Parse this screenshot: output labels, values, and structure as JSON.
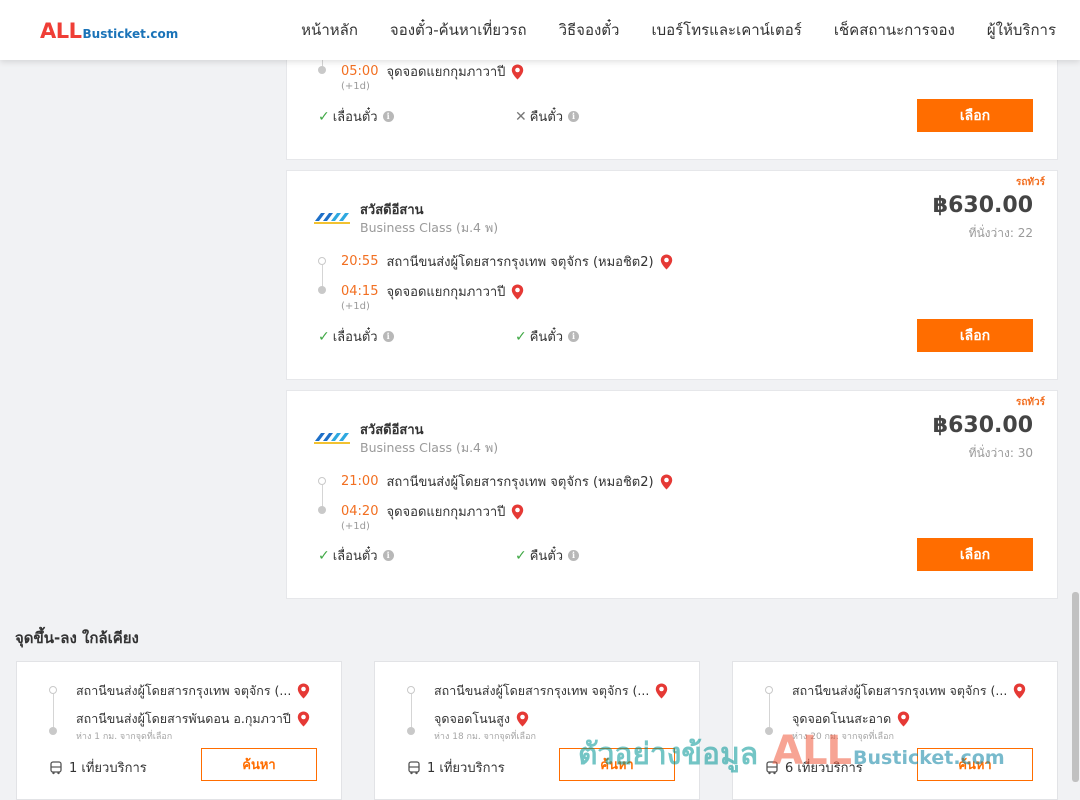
{
  "brand": {
    "logo_all": "ALL",
    "logo_rest": "Busticket.com"
  },
  "nav": [
    "หน้าหลัก",
    "จองตั๋ว-ค้นหาเที่ยวรถ",
    "วิธีจองตั๋ว",
    "เบอร์โทรและเคาน์เตอร์",
    "เช็คสถานะการจอง",
    "ผู้ให้บริการ"
  ],
  "trips": [
    {
      "arrival_time": "05:00",
      "arrival_place": "จุดจอดแยกกุมภาวาปี",
      "arrival_day_offset": "(+1d)",
      "change_label": "เลื่อนตั๋ว",
      "change_allowed": true,
      "refund_label": "คืนตั๋ว",
      "refund_allowed": false,
      "select_label": "เลือก"
    },
    {
      "tag": "รถทัวร์",
      "operator": "สวัสดีอีสาน",
      "class": "Business Class (ม.4 พ)",
      "price": "฿630.00",
      "seats": "ที่นั่งว่าง: 22",
      "departure_time": "20:55",
      "departure_place": "สถานีขนส่งผู้โดยสารกรุงเทพ จตุจักร (หมอชิต2)",
      "arrival_time": "04:15",
      "arrival_place": "จุดจอดแยกกุมภาวาปี",
      "arrival_day_offset": "(+1d)",
      "change_label": "เลื่อนตั๋ว",
      "change_allowed": true,
      "refund_label": "คืนตั๋ว",
      "refund_allowed": true,
      "select_label": "เลือก"
    },
    {
      "tag": "รถทัวร์",
      "operator": "สวัสดีอีสาน",
      "class": "Business Class (ม.4 พ)",
      "price": "฿630.00",
      "seats": "ที่นั่งว่าง: 30",
      "departure_time": "21:00",
      "departure_place": "สถานีขนส่งผู้โดยสารกรุงเทพ จตุจักร (หมอชิต2)",
      "arrival_time": "04:20",
      "arrival_place": "จุดจอดแยกกุมภาวาปี",
      "arrival_day_offset": "(+1d)",
      "change_label": "เลื่อนตั๋ว",
      "change_allowed": true,
      "refund_label": "คืนตั๋ว",
      "refund_allowed": true,
      "select_label": "เลือก"
    }
  ],
  "nearby": {
    "title": "จุดขึ้น-ลง ใกล้เคียง",
    "items": [
      {
        "from": "สถานีขนส่งผู้โดยสารกรุงเทพ จตุจักร (...",
        "to": "สถานีขนส่งผู้โดยสารพันดอน อ.กุมภวาปี",
        "distance": "ห่าง 1 กม. จากจุดที่เลือก",
        "trips": "1 เที่ยวบริการ",
        "search_label": "ค้นหา"
      },
      {
        "from": "สถานีขนส่งผู้โดยสารกรุงเทพ จตุจักร (...",
        "to": "จุดจอดโนนสูง",
        "distance": "ห่าง 18 กม. จากจุดที่เลือก",
        "trips": "1 เที่ยวบริการ",
        "search_label": "ค้นหา"
      },
      {
        "from": "สถานีขนส่งผู้โดยสารกรุงเทพ จตุจักร (...",
        "to": "จุดจอดโนนสะอาด",
        "distance": "ห่าง 20 กม. จากจุดที่เลือก",
        "trips": "6 เที่ยวบริการ",
        "search_label": "ค้นหา"
      }
    ]
  },
  "watermark": {
    "text": "ตัวอย่างข้อมูล",
    "all": "ALL",
    "rest": "Busticket.com"
  },
  "colors": {
    "accent": "#ff6d00",
    "time": "#f26f21",
    "ok": "#3fa845",
    "pin": "#e53935",
    "brand_red": "#ef3e36",
    "brand_blue": "#1a73b8"
  },
  "icons": {
    "pin": "map-pin-icon",
    "check": "check-icon",
    "cross": "cross-icon",
    "info": "info-icon",
    "bus": "bus-icon",
    "operator_logo": "operator-logo"
  }
}
